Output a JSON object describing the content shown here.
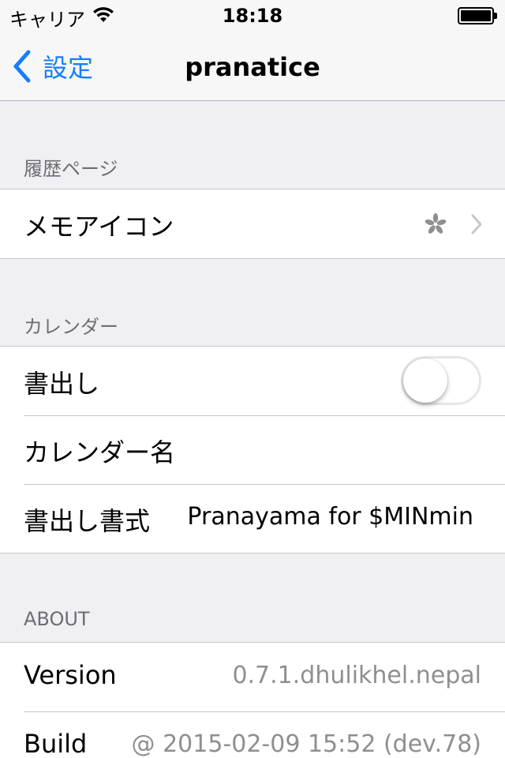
{
  "status_bar": {
    "carrier": "キャリア",
    "time": "18:18"
  },
  "nav": {
    "back_label": "設定",
    "title": "pranatice"
  },
  "sections": {
    "history": {
      "header": "履歴ページ",
      "memo_icon_label": "メモアイコン"
    },
    "calendar": {
      "header": "カレンダー",
      "export_label": "書出し",
      "export_enabled": false,
      "calendar_name_label": "カレンダー名",
      "export_format_label": "書出し書式",
      "export_format_value": "Pranayama for $MINmin"
    },
    "about": {
      "header": "ABOUT",
      "version_label": "Version",
      "version_value": "0.7.1.dhulikhel.nepal",
      "build_label": "Build",
      "build_value": "@ 2015-02-09 15:52 (dev.78)"
    }
  },
  "colors": {
    "accent": "#157efb",
    "background": "#efeff4",
    "secondary_text": "#8e8e93"
  },
  "icons": {
    "back": "chevron-left-icon",
    "wifi": "wifi-icon",
    "battery": "battery-icon",
    "memo": "flower-icon",
    "disclosure": "chevron-right-icon"
  }
}
